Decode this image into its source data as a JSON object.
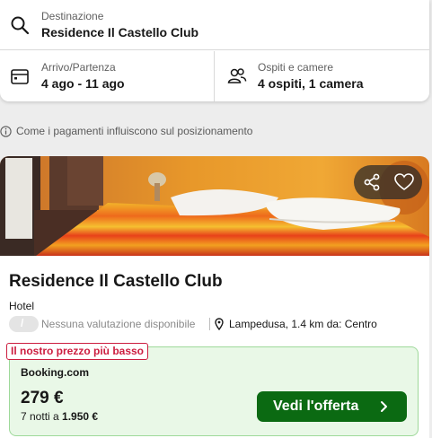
{
  "search": {
    "destination_label": "Destinazione",
    "destination_value": "Residence Il Castello Club",
    "dates_label": "Arrivo/Partenza",
    "dates_value": "4 ago - 11 ago",
    "guests_label": "Ospiti e camere",
    "guests_value": "4 ospiti, 1 camera",
    "icons": [
      "search-icon",
      "calendar-icon",
      "guests-icon"
    ]
  },
  "info": {
    "text": "Come i pagamenti influiscono sul posizionamento",
    "icon": "info-icon"
  },
  "result": {
    "hotel_name": "Residence Il Castello Club",
    "type": "Hotel",
    "rating_badge": "/",
    "rating_text": "Nessuna valutazione disponibile",
    "location": "Lampedusa, 1.4 km da: Centro",
    "photo_actions": [
      "share-icon",
      "favorite-heart-icon"
    ],
    "offer": {
      "badge": "Il nostro prezzo più basso",
      "provider": "Booking.com",
      "price": "279 €",
      "nights_prefix": "7 notti a",
      "nights_total": "1.950 €",
      "cta_label": "Vedi l'offerta"
    }
  },
  "colors": {
    "cta_green": "#0b6a12",
    "offer_bg": "#e9f8e7",
    "badge_red": "#cc1d3f"
  }
}
